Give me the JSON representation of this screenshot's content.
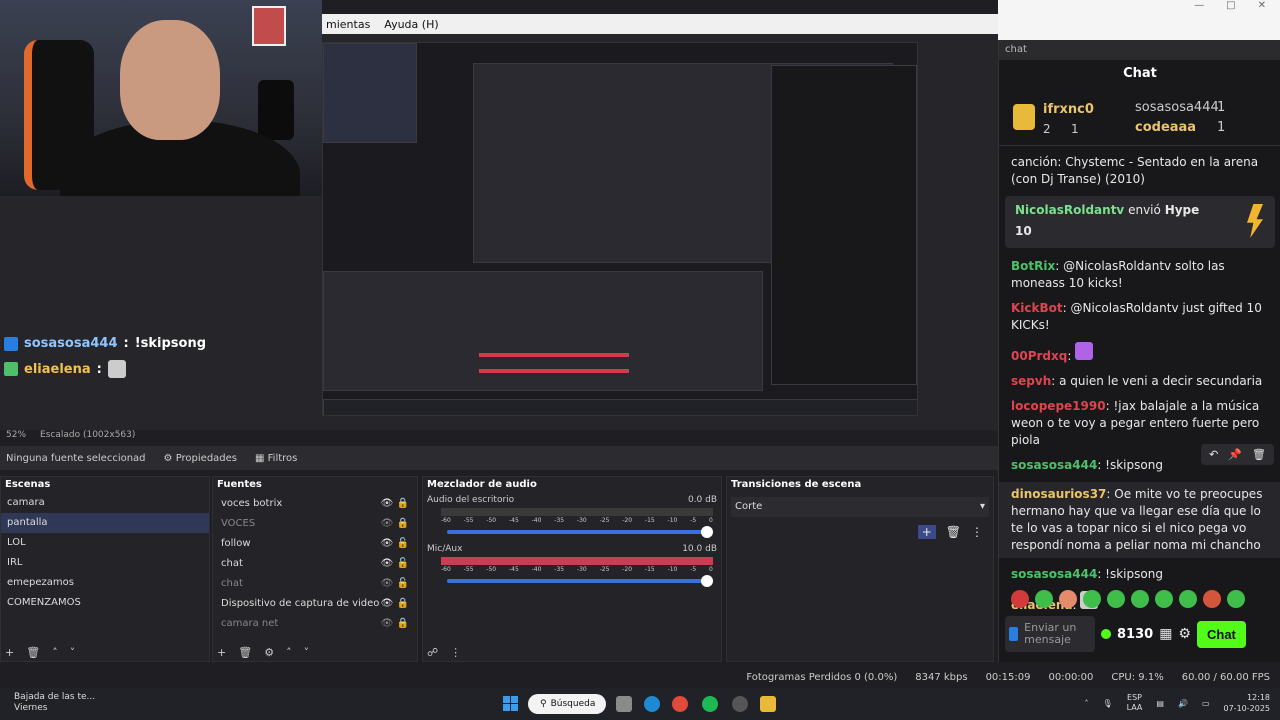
{
  "menubar": {
    "item1": "mientas",
    "item2": "Ayuda (H)"
  },
  "overlay": {
    "line1_user": "sosasosa444",
    "line1_sep": ":",
    "line1_text": "!skipsong",
    "line2_user": "eliaelena",
    "line2_sep": ":"
  },
  "chat": {
    "tab": "chat",
    "title": "Chat",
    "leaderboard": {
      "first_name": "ifrxnc0",
      "first_count": "1",
      "rank2": "2",
      "second_name": "sosasosa444",
      "second_count": "1",
      "third_name": "codeaaa",
      "third_count": "1"
    },
    "song": "canción: Chystemc - Sentado en la arena (con Dj Transe) (2010)",
    "hype": {
      "user": "NicolasRoldantv",
      "text": "envió",
      "word": "Hype",
      "amount": "10"
    },
    "messages": [
      {
        "user": "BotRix",
        "text": "@NicolasRoldantv solto las moneass 10 kicks!"
      },
      {
        "user": "KickBot",
        "text": "@NicolasRoldantv just gifted 10 KICKs!"
      },
      {
        "user": "00Prdxq",
        "text": ""
      },
      {
        "user": "sepvh",
        "text": "a quien le veni a decir secundaria"
      },
      {
        "user": "locopepe1990",
        "text": "!jax balajale a la música weon o te voy a pegar entero fuerte pero piola"
      },
      {
        "user": "sosasosa444",
        "text": "!skipsong"
      },
      {
        "user": "dinosaurios37",
        "text": "Oe mite vo te preocupes hermano hay que va llegar ese día que lo te lo vas a topar nico si el nico pega vo respondí noma a peliar noma mi chancho"
      },
      {
        "user": "sosasosa444",
        "text": "!skipsong"
      },
      {
        "user": "eliaelena",
        "text": ""
      }
    ],
    "input_placeholder": "Enviar un mensaje",
    "points": "8130",
    "send_label": "Chat",
    "colors": {
      "send": "#53fc18",
      "accent_green": "#4cc16a"
    }
  },
  "obs": {
    "zoom": "52%",
    "scale": "Escalado (1002x563)",
    "no_source": "Ninguna fuente seleccionad",
    "properties_label": "Propiedades",
    "filters_label": "Filtros",
    "scenes_title": "Escenas",
    "scenes": [
      "camara",
      "pantalla",
      "LOL",
      "IRL",
      "emepezamos",
      "COMENZAMOS"
    ],
    "sources_title": "Fuentes",
    "sources": [
      "voces botrix",
      "VOCES",
      "follow",
      "chat",
      "chat",
      "Dispositivo de captura de video",
      "camara net"
    ],
    "mixer_title": "Mezclador de audio",
    "mixer": [
      {
        "name": "Audio del escritorio",
        "db": "0.0 dB"
      },
      {
        "name": "Mic/Aux",
        "db": "10.0 dB"
      }
    ],
    "ticks": [
      "-60",
      "-55",
      "-50",
      "-45",
      "-40",
      "-35",
      "-30",
      "-25",
      "-20",
      "-15",
      "-10",
      "-5",
      "0"
    ],
    "transitions_title": "Transiciones de escena",
    "transition": "Corte",
    "stats": {
      "dropped": "Fotogramas Perdidos 0 (0.0%)",
      "kbps": "8347 kbps",
      "stream_time": "00:15:09",
      "rec_time": "00:00:00",
      "cpu": "CPU: 9.1%",
      "fps": "60.00 / 60.00 FPS"
    }
  },
  "taskbar": {
    "weather_title": "Bajada de las te...",
    "weather_sub": "Viernes",
    "search": "Búsqueda",
    "lang1": "ESP",
    "lang2": "LAA",
    "time": "12:18",
    "date": "07-10-2025"
  }
}
